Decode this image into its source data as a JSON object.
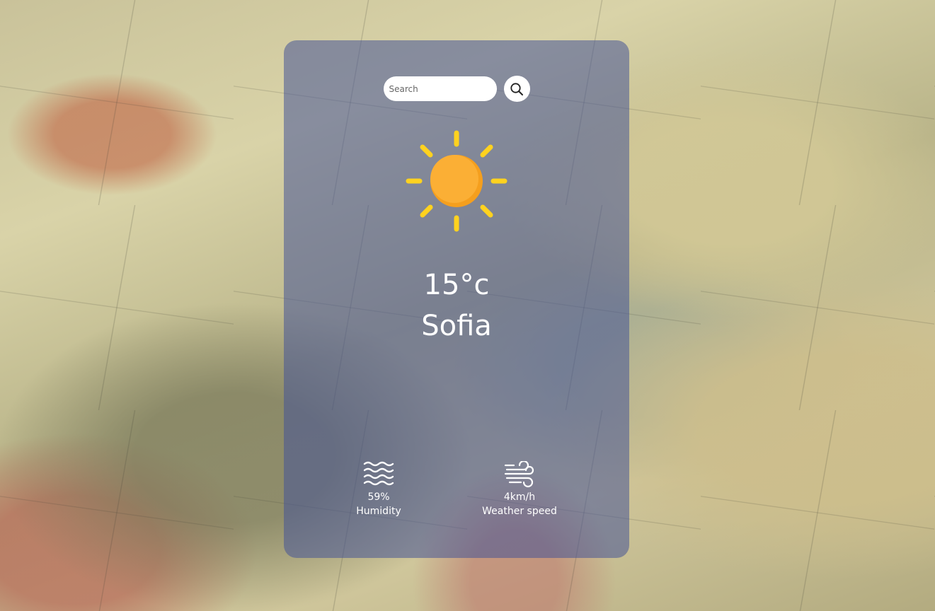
{
  "search": {
    "placeholder": "Search"
  },
  "weather": {
    "icon": "sun-icon",
    "temperature": "15°c",
    "city": "Sofia"
  },
  "stats": {
    "humidity": {
      "icon": "waves-icon",
      "value": "59%",
      "label": "Humidity"
    },
    "wind": {
      "icon": "wind-icon",
      "value": "4km/h",
      "label": "Weather speed"
    }
  },
  "colors": {
    "card": "#46549680",
    "sun_body": "#FBAF35",
    "sun_rays": "#FFD21F",
    "text": "#FFFFFF"
  }
}
